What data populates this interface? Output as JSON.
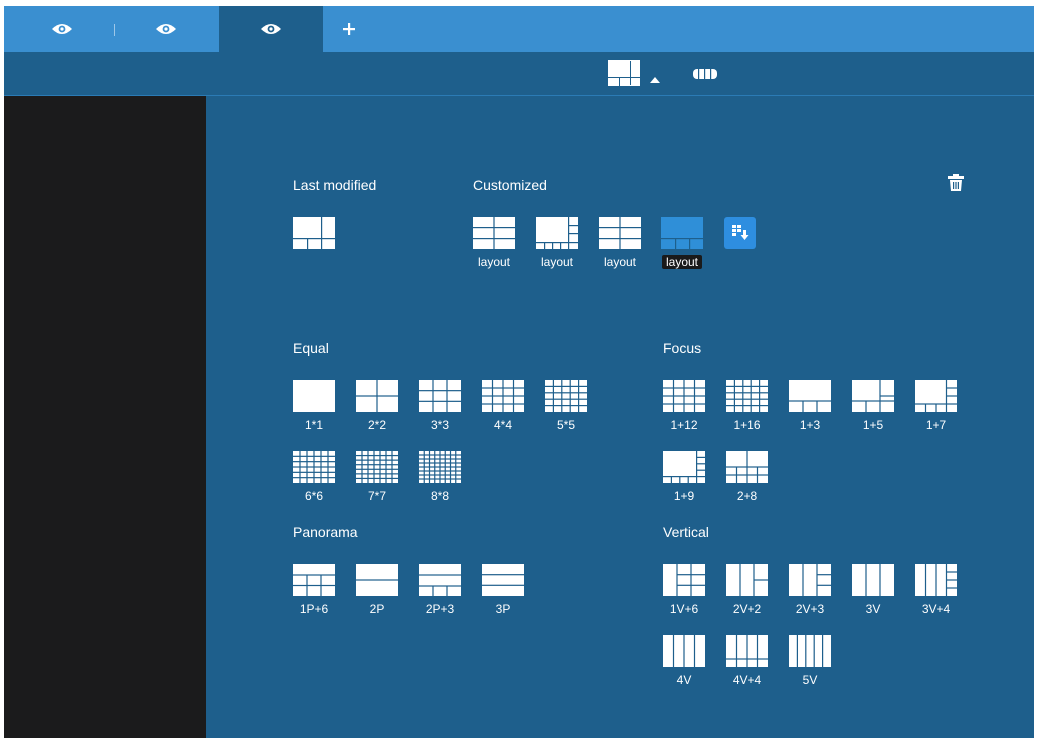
{
  "tabs": [
    {
      "icon": "eye-icon",
      "active": false
    },
    {
      "icon": "eye-icon",
      "active": false
    },
    {
      "icon": "eye-icon",
      "active": true
    }
  ],
  "add_tab_icon": "plus-icon",
  "toolbar": {
    "layout_icon": "layout-grid-icon",
    "caret_icon": "caret-up-icon",
    "panorama_icon": "fisheye-icon"
  },
  "sections": {
    "last_modified": "Last modified",
    "customized": "Customized",
    "equal": "Equal",
    "focus": "Focus",
    "panorama": "Panorama",
    "vertical": "Vertical"
  },
  "delete_icon": "trash-icon",
  "import_icon": "import-layout-icon",
  "customized_labels": [
    "layout",
    "layout",
    "layout",
    "layout"
  ],
  "equal_labels": [
    "1*1",
    "2*2",
    "3*3",
    "4*4",
    "5*5",
    "6*6",
    "7*7",
    "8*8"
  ],
  "focus_labels": [
    "1+12",
    "1+16",
    "1+3",
    "1+5",
    "1+7",
    "1+9",
    "2+8"
  ],
  "panorama_labels": [
    "1P+6",
    "2P",
    "2P+3",
    "3P"
  ],
  "vertical_labels": [
    "1V+6",
    "2V+2",
    "2V+3",
    "3V",
    "3V+4",
    "4V",
    "4V+4",
    "5V"
  ],
  "colors": {
    "frame": "#1e5f8c",
    "tabbar": "#3a8fd0",
    "sidebar": "#1b1b1c",
    "selected": "#2f8fd8",
    "import_button": "#2e8ee0"
  }
}
